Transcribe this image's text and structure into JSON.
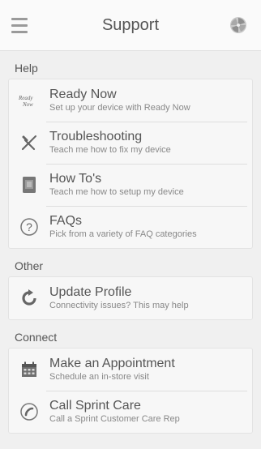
{
  "header": {
    "title": "Support",
    "menu_icon": "hamburger-menu-icon",
    "right_icon": "pinwheel-icon"
  },
  "sections": [
    {
      "label": "Help",
      "items": [
        {
          "title": "Ready Now",
          "subtitle": "Set up your device with Ready Now",
          "icon": "ready-now-logo-icon",
          "icon_text": "Ready Now"
        },
        {
          "title": "Troubleshooting",
          "subtitle": "Teach me how to fix my device",
          "icon": "tools-icon"
        },
        {
          "title": "How To's",
          "subtitle": "Teach me how to setup my device",
          "icon": "device-icon"
        },
        {
          "title": "FAQs",
          "subtitle": "Pick from a variety of FAQ categories",
          "icon": "question-circle-icon"
        }
      ]
    },
    {
      "label": "Other",
      "items": [
        {
          "title": "Update Profile",
          "subtitle": "Connectivity issues? This may help",
          "icon": "refresh-arrow-icon"
        }
      ]
    },
    {
      "label": "Connect",
      "items": [
        {
          "title": "Make an Appointment",
          "subtitle": "Schedule an in-store visit",
          "icon": "calendar-icon"
        },
        {
          "title": "Call Sprint Care",
          "subtitle": "Call a Sprint Customer Care Rep",
          "icon": "phone-icon"
        }
      ]
    }
  ]
}
